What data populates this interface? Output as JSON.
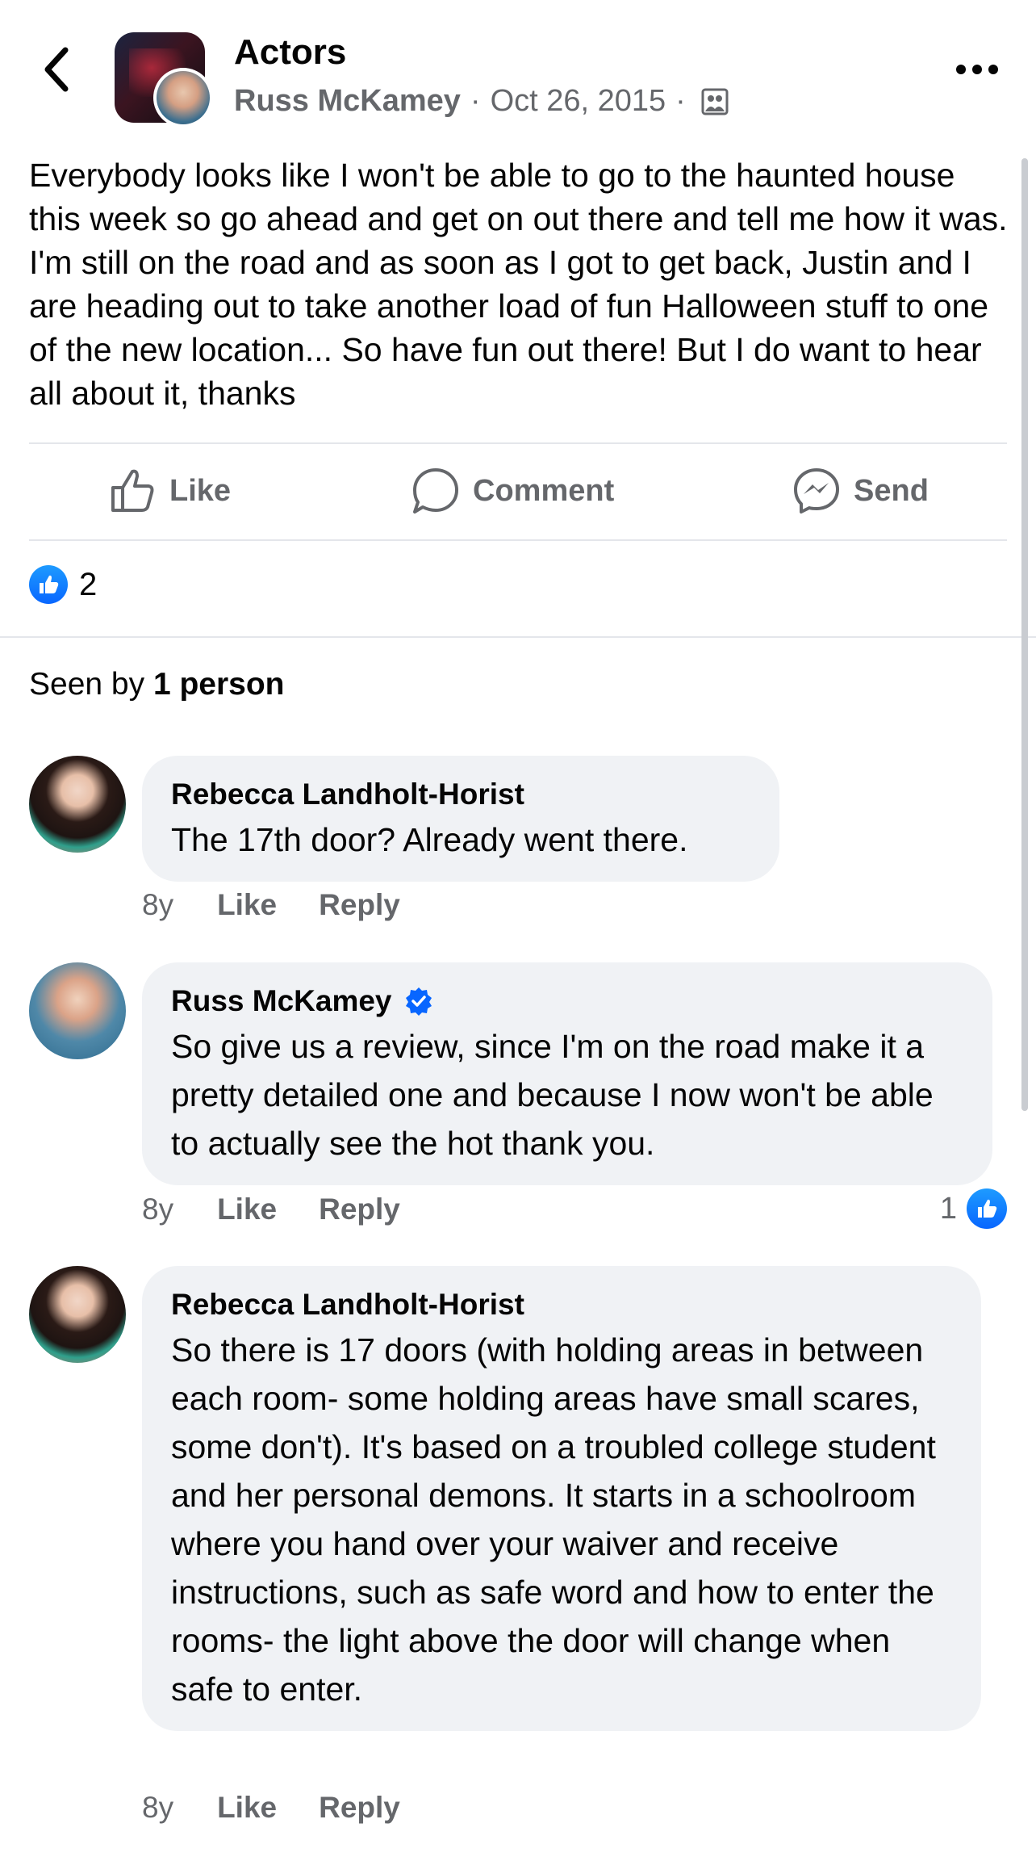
{
  "header": {
    "group_name": "Actors",
    "author": "Russ McKamey",
    "date": "Oct 26, 2015",
    "separator": "·"
  },
  "post": {
    "text": "Everybody looks like I won't be able to go to the haunted house this week so go ahead and get on out there and tell me how it was. I'm still on the road and as soon as I got to get back, Justin and I are heading out to take another load of fun Halloween stuff to one of the new location... So have fun out there! But I do want to hear all about it, thanks"
  },
  "actions": {
    "like": "Like",
    "comment": "Comment",
    "send": "Send"
  },
  "reactions": {
    "count": "2"
  },
  "seen_by": {
    "prefix": "Seen by",
    "count_text": "1 person"
  },
  "comments": [
    {
      "name": "Rebecca Landholt-Horist",
      "text": "The 17th door? Already went there.",
      "age": "8y",
      "like": "Like",
      "reply": "Reply"
    },
    {
      "name": "Russ McKamey",
      "verified": true,
      "text": "So give us a review, since I'm on the road make it a pretty detailed one and because I now won't be able to actually see the hot thank you.",
      "age": "8y",
      "like": "Like",
      "reply": "Reply",
      "reactions": "1"
    },
    {
      "name": "Rebecca Landholt-Horist",
      "text": "So there is 17 doors (with holding areas in between each room- some holding areas have small scares, some don't). It's based on a troubled college student and her personal demons. It starts in a schoolroom where you hand over your waiver and receive instructions, such as safe word and how to enter the rooms- the light above the door will change when safe to enter.",
      "age": "8y",
      "like": "Like",
      "reply": "Reply"
    }
  ],
  "colors": {
    "accent_blue": "#0866ff",
    "secondary_text": "#65676b",
    "bubble_bg": "#f0f2f5",
    "divider": "#e4e6eb"
  },
  "icons": [
    "back-chevron-icon",
    "more-icon",
    "group-icon",
    "thumbs-up-icon",
    "comment-icon",
    "messenger-icon",
    "like-reaction-icon",
    "verified-badge-icon"
  ]
}
